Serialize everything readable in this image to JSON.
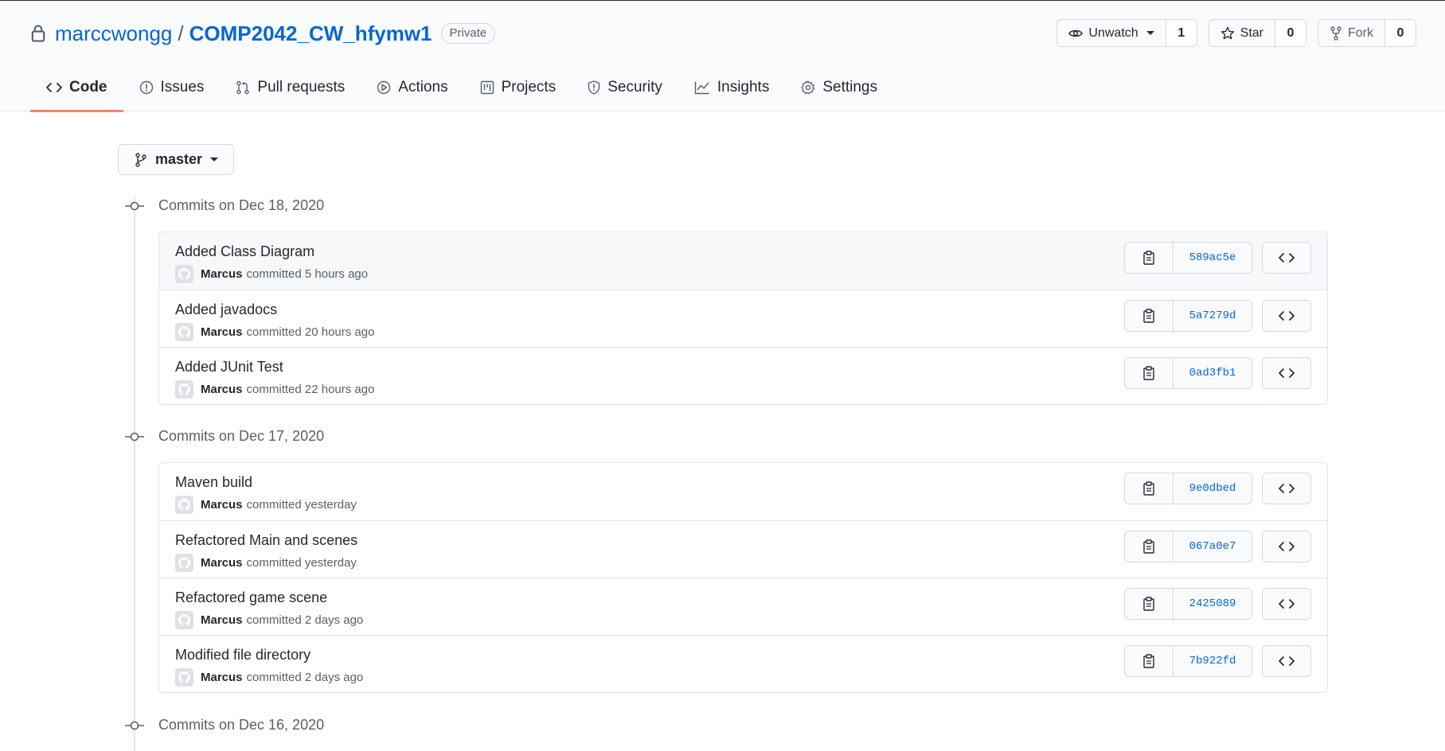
{
  "repo": {
    "owner": "marccwongg",
    "separator": "/",
    "name": "COMP2042_CW_hfymw1",
    "visibility": "Private"
  },
  "header_actions": {
    "unwatch_label": "Unwatch",
    "unwatch_count": "1",
    "star_label": "Star",
    "star_count": "0",
    "fork_label": "Fork",
    "fork_count": "0"
  },
  "tabs": [
    {
      "label": "Code",
      "icon": "code-icon",
      "active": true
    },
    {
      "label": "Issues",
      "icon": "issue-icon"
    },
    {
      "label": "Pull requests",
      "icon": "pull-request-icon"
    },
    {
      "label": "Actions",
      "icon": "play-icon"
    },
    {
      "label": "Projects",
      "icon": "project-icon"
    },
    {
      "label": "Security",
      "icon": "shield-icon"
    },
    {
      "label": "Insights",
      "icon": "graph-icon"
    },
    {
      "label": "Settings",
      "icon": "gear-icon"
    }
  ],
  "branch": {
    "name": "master"
  },
  "groups": [
    {
      "title": "Commits on Dec 18, 2020",
      "commits": [
        {
          "message": "Added Class Diagram",
          "author": "Marcus",
          "action": "committed",
          "time": "5 hours ago",
          "sha": "589ac5e"
        },
        {
          "message": "Added javadocs",
          "author": "Marcus",
          "action": "committed",
          "time": "20 hours ago",
          "sha": "5a7279d"
        },
        {
          "message": "Added JUnit Test",
          "author": "Marcus",
          "action": "committed",
          "time": "22 hours ago",
          "sha": "0ad3fb1"
        }
      ]
    },
    {
      "title": "Commits on Dec 17, 2020",
      "commits": [
        {
          "message": "Maven build",
          "author": "Marcus",
          "action": "committed",
          "time": "yesterday",
          "sha": "9e0dbed"
        },
        {
          "message": "Refactored Main and scenes",
          "author": "Marcus",
          "action": "committed",
          "time": "yesterday",
          "sha": "067a0e7"
        },
        {
          "message": "Refactored game scene",
          "author": "Marcus",
          "action": "committed",
          "time": "2 days ago",
          "sha": "2425089"
        },
        {
          "message": "Modified file directory",
          "author": "Marcus",
          "action": "committed",
          "time": "2 days ago",
          "sha": "7b922fd"
        }
      ]
    },
    {
      "title": "Commits on Dec 16, 2020",
      "commits": []
    }
  ],
  "colors": {
    "link": "#0366d6",
    "accent_underline": "#f9826c",
    "muted": "#586069",
    "text": "#24292e"
  }
}
